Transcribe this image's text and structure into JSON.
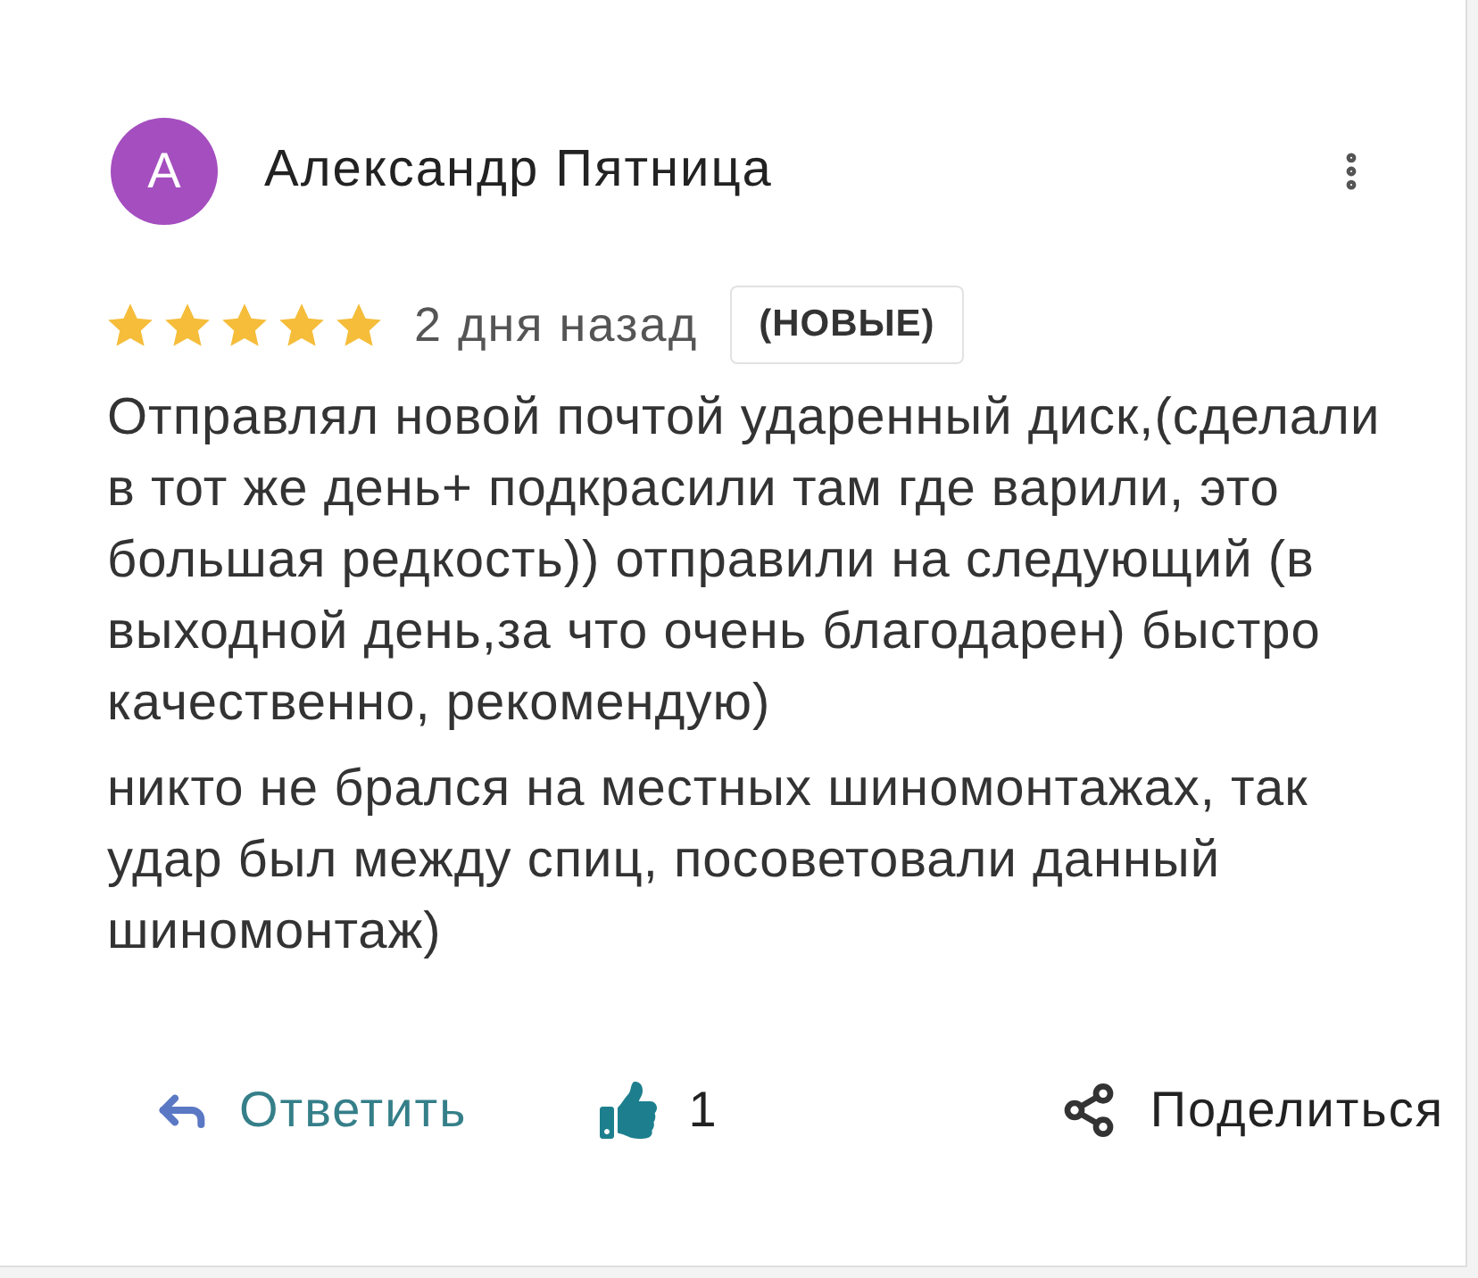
{
  "review": {
    "author": {
      "initial": "А",
      "name": "Александр Пятница"
    },
    "stars": 5,
    "date": "2 дня назад",
    "badge": "(НОВЫЕ)",
    "paragraphs": [
      "Отправлял новой почтой ударенный диск,(сделали в тот же день+ подкрасили там где варили, это большая редкость)) отправили на следующий (в выходной день,за что очень благодарен) быстро качественно, рекомендую)",
      "никто не брался на местных шиномонтажах, так удар был между спиц, посоветовали данный шиномонтаж)"
    ]
  },
  "actions": {
    "reply": "Ответить",
    "likes": "1",
    "share": "Поделиться"
  }
}
